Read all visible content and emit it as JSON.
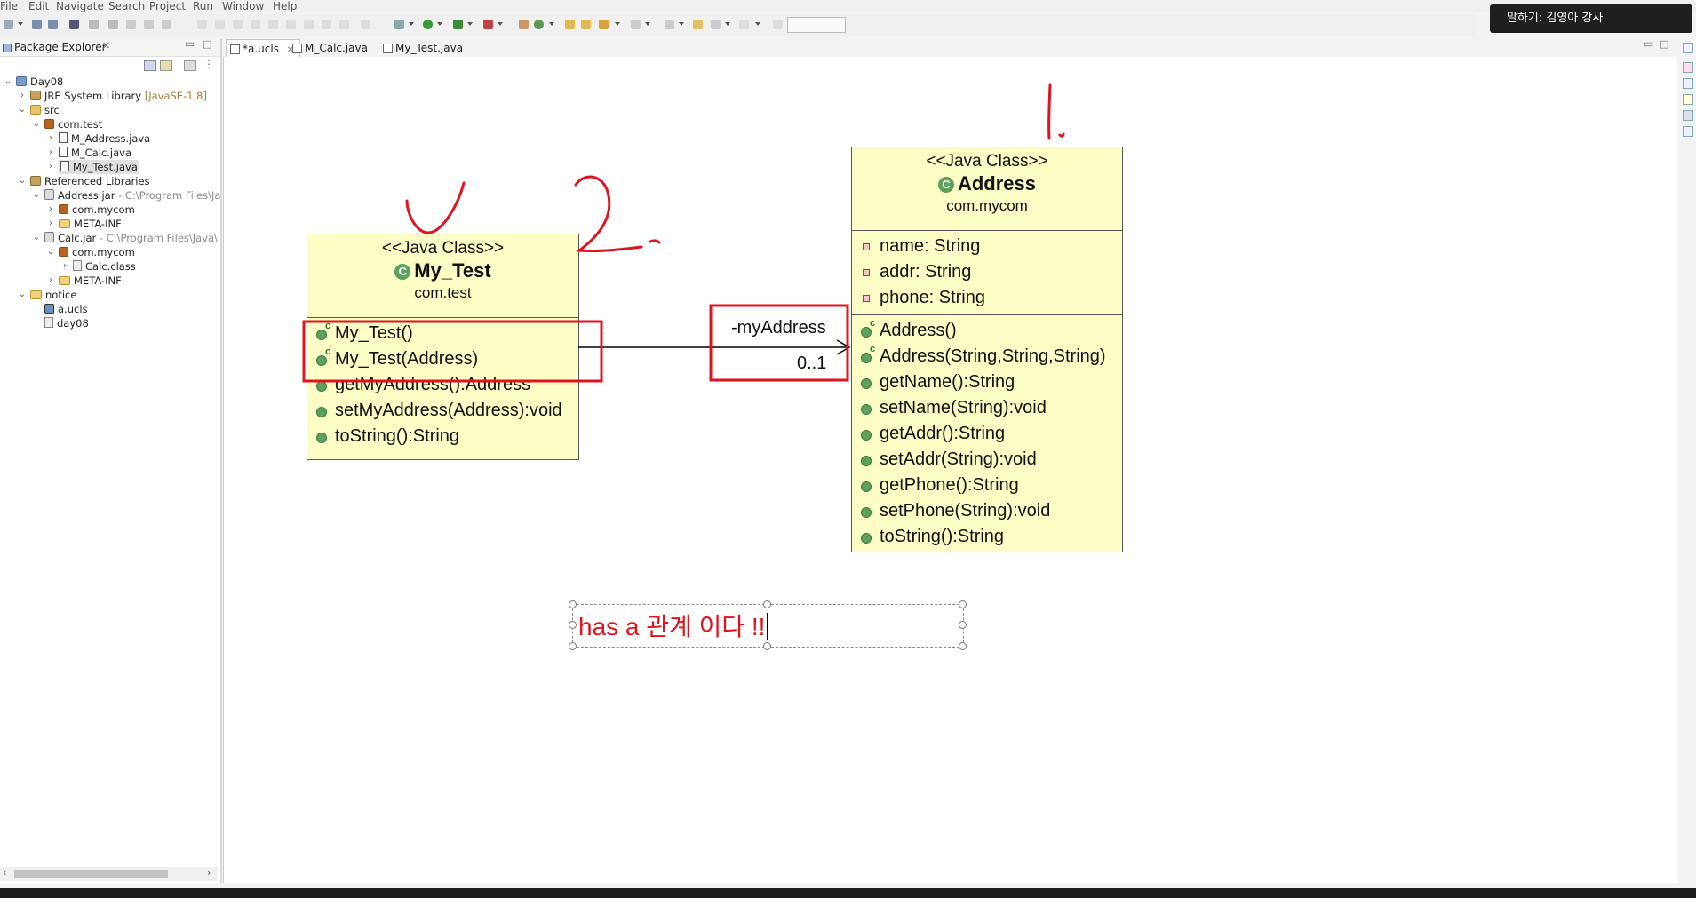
{
  "menu": [
    "File",
    "Edit",
    "Navigate",
    "Search",
    "Project",
    "Run",
    "Window",
    "Help"
  ],
  "notification": {
    "text": "말하기: 김영아 강사"
  },
  "package_explorer": {
    "title": "Package Explorer",
    "tree": [
      {
        "label": "Day08",
        "icon": "project-icon"
      },
      {
        "label": "JRE System Library",
        "suffix": "[JavaSE-1.8]",
        "icon": "library-icon"
      },
      {
        "label": "src",
        "icon": "source-folder-icon"
      },
      {
        "label": "com.test",
        "icon": "package-icon"
      },
      {
        "label": "M_Address.java",
        "icon": "java-file-icon"
      },
      {
        "label": "M_Calc.java",
        "icon": "java-file-icon"
      },
      {
        "label": "My_Test.java",
        "icon": "java-file-icon",
        "selected": true
      },
      {
        "label": "Referenced Libraries",
        "icon": "library-icon"
      },
      {
        "label": "Address.jar",
        "suffix": "- C:\\Program Files\\Ja",
        "icon": "jar-icon"
      },
      {
        "label": "com.mycom",
        "icon": "package-icon"
      },
      {
        "label": "META-INF",
        "icon": "folder-icon"
      },
      {
        "label": "Calc.jar",
        "suffix": "- C:\\Program Files\\Java\\",
        "icon": "jar-icon"
      },
      {
        "label": "com.mycom",
        "icon": "package-icon"
      },
      {
        "label": "Calc.class",
        "icon": "class-file-icon"
      },
      {
        "label": "META-INF",
        "icon": "folder-icon"
      },
      {
        "label": "notice",
        "icon": "folder-icon"
      },
      {
        "label": "a.ucls",
        "icon": "ucls-file-icon"
      },
      {
        "label": "day08",
        "icon": "file-icon"
      }
    ]
  },
  "editor_tabs": [
    "*a.ucls",
    "M_Calc.java",
    "My_Test.java"
  ],
  "diagram": {
    "my_test": {
      "stereotype": "<<Java Class>>",
      "name": "My_Test",
      "package": "com.test",
      "constructors": [
        "My_Test()",
        "My_Test(Address)"
      ],
      "methods": [
        "getMyAddress():Address",
        "setMyAddress(Address):void",
        "toString():String"
      ]
    },
    "address": {
      "stereotype": "<<Java Class>>",
      "name": "Address",
      "package": "com.mycom",
      "fields": [
        "name: String",
        "addr: String",
        "phone: String"
      ],
      "constructors": [
        "Address()",
        "Address(String,String,String)"
      ],
      "methods": [
        "getName():String",
        "setName(String):void",
        "getAddr():String",
        "setAddr(String):void",
        "getPhone():String",
        "setPhone(String):void",
        "toString():String"
      ]
    },
    "association": {
      "role": "-myAddress",
      "multiplicity": "0..1"
    },
    "note": "has a 관계 이다 !!"
  },
  "annotation_color": "#e0141e"
}
